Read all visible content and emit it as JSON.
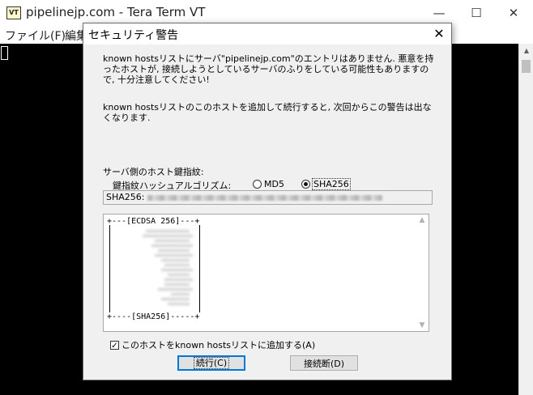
{
  "main_window": {
    "app_icon": "VT",
    "title": "pipelinejp.com - Tera Term VT",
    "controls": {
      "minimize": "—",
      "maximize": "☐",
      "close": "✕"
    },
    "menu": {
      "file": "ファイル(F)",
      "edit": "編集"
    }
  },
  "dialog": {
    "title": "セキュリティ警告",
    "close": "✕",
    "message1": "known hostsリストにサーバ\"pipelinejp.com\"のエントリはありません. 悪意を持ったホストが, 接続しようとしているサーバのふりをしている可能性もありますので, 十分注意してください!",
    "message2": "known hostsリストのこのホストを追加して続行すると, 次回からこの警告は出なくなります.",
    "fingerprint_label": "サーバ側のホスト鍵指紋:",
    "algorithm_label": "鍵指紋ハッシュアルゴリズム:",
    "radio_md5": "MD5",
    "radio_sha256": "SHA256",
    "selected_algorithm": "SHA256",
    "fingerprint_prefix": "SHA256:",
    "randomart_top": "+---[ECDSA 256]---+",
    "randomart_bottom": "+----[SHA256]-----+",
    "add_checkbox_label": "このホストをknown hostsリストに追加する(A)",
    "add_checkbox_checked": true,
    "checkmark": "✓",
    "continue_button": "続行(C)",
    "disconnect_button": "接続断(D)",
    "scroll_up": "▲",
    "scroll_down": "▼"
  }
}
